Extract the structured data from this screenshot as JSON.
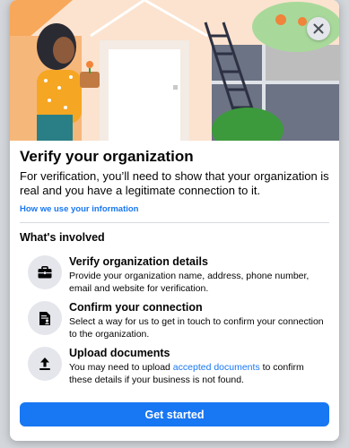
{
  "dialog": {
    "title": "Verify your organization",
    "description": "For verification, you’ll need to show that your organization is real and you have a legitimate connection to it.",
    "info_link": "How we use your information",
    "section_title": "What's involved",
    "steps": [
      {
        "title": "Verify organization details",
        "description": "Provide your organization name, address, phone number, email and website for verification.",
        "icon": "briefcase-icon"
      },
      {
        "title": "Confirm your connection",
        "description": "Select a way for us to get in touch to confirm your connection to the organization.",
        "icon": "document-person-icon"
      },
      {
        "title": "Upload documents",
        "description_before": "You may need to upload ",
        "description_link": "accepted documents",
        "description_after": " to confirm these details if your business is not found.",
        "icon": "upload-icon"
      }
    ],
    "cta_label": "Get started",
    "close_icon": "close-icon"
  },
  "colors": {
    "accent": "#1877f2",
    "icon_circle": "#e4e6eb",
    "text": "#050505"
  }
}
